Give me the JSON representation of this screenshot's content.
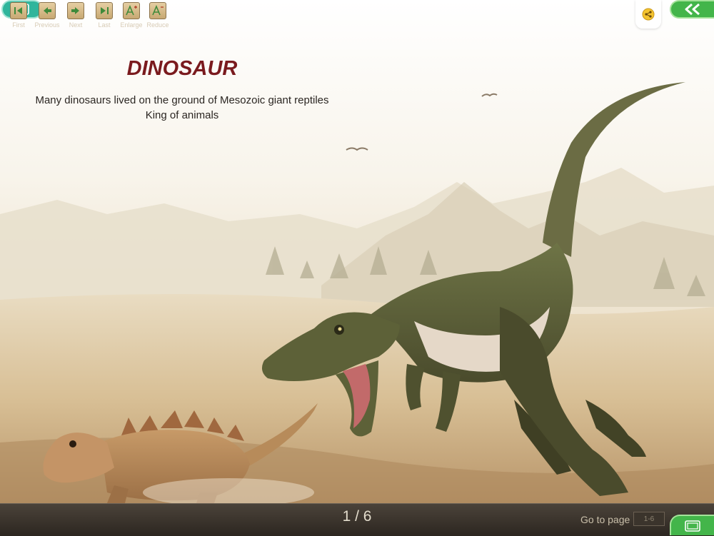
{
  "header": {
    "video_icon": "film-icon",
    "share_icon": "share-icon",
    "back_icon": "double-chevron-left-icon"
  },
  "content": {
    "title": "DINOSAUR",
    "description_line1": "Many dinosaurs lived on the ground of Mesozoic giant reptiles",
    "description_line2": "King of animals"
  },
  "toolbar": {
    "buttons": [
      {
        "label": "First",
        "icon": "first-page-icon"
      },
      {
        "label": "Previous",
        "icon": "previous-page-icon"
      },
      {
        "label": "Next",
        "icon": "next-page-icon"
      },
      {
        "label": "Last",
        "icon": "last-page-icon"
      },
      {
        "label": "Enlarge",
        "icon": "enlarge-text-icon"
      },
      {
        "label": "Reduce",
        "icon": "reduce-text-icon"
      }
    ],
    "page_indicator": "1 / 6",
    "goto_label": "Go to page",
    "goto_placeholder": "1-6",
    "slideshow_icon": "slideshow-icon"
  },
  "colors": {
    "title": "#7a1a1e",
    "accent_teal": "#2fb59c",
    "accent_green": "#43b54a",
    "toolbar_bg": "#2c2620"
  }
}
